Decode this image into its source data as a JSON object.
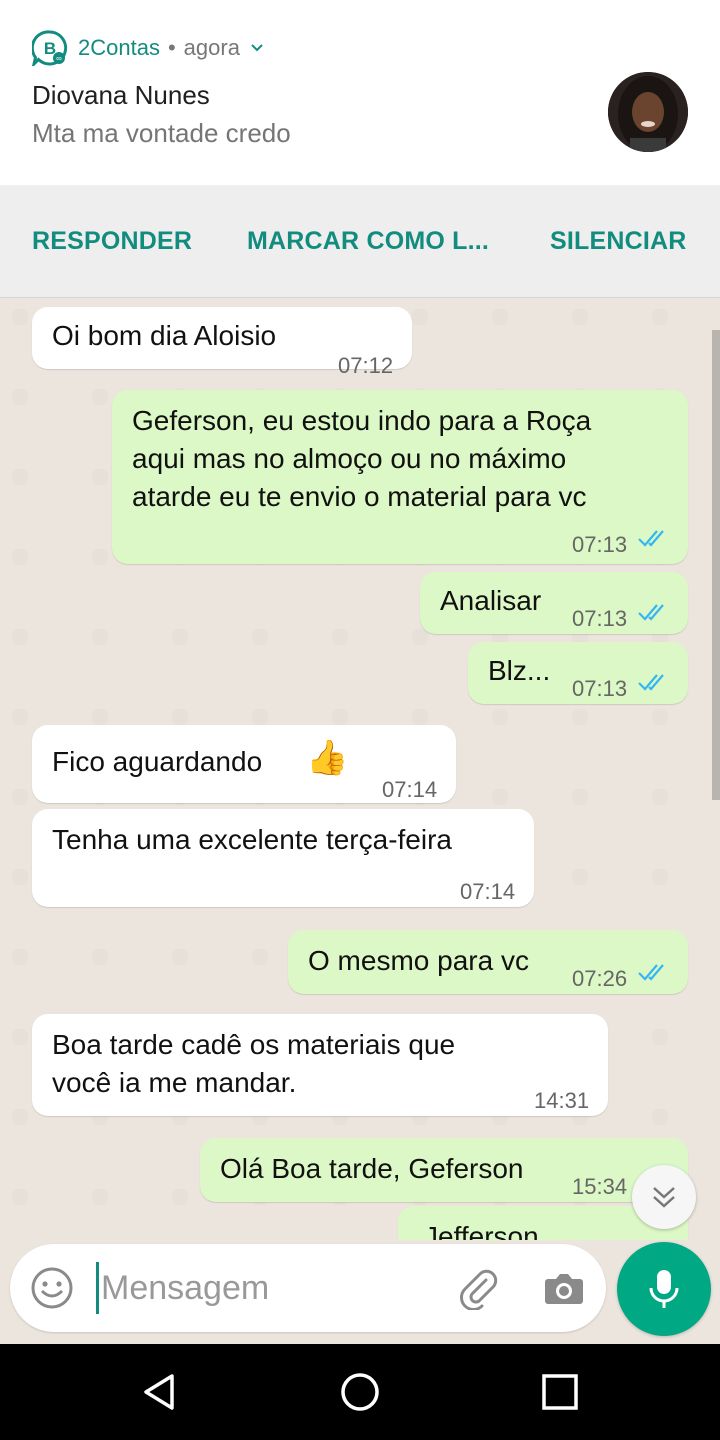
{
  "notification": {
    "app_name": "2Contas",
    "time": "agora",
    "sender": "Diovana Nunes",
    "preview": "Mta ma vontade credo",
    "actions": [
      "RESPONDER",
      "MARCAR COMO L...",
      "SILENCIAR"
    ],
    "accent_color": "#128c7e"
  },
  "messages": [
    {
      "dir": "in",
      "text": "Oi bom dia Aloisio",
      "time": "07:12"
    },
    {
      "dir": "out",
      "lines": [
        "Geferson, eu estou indo para a Roça",
        "aqui mas no almoço ou no máximo",
        "atarde eu te envio o material para vc"
      ],
      "time": "07:13",
      "status": "read"
    },
    {
      "dir": "out",
      "text": "Analisar",
      "time": "07:13",
      "status": "read"
    },
    {
      "dir": "out",
      "text": "Blz...",
      "time": "07:13",
      "status": "read"
    },
    {
      "dir": "in",
      "text": "Fico aguardando",
      "emoji": "👍",
      "time": "07:14"
    },
    {
      "dir": "in",
      "text": "Tenha uma excelente  terça-feira",
      "time": "07:14"
    },
    {
      "dir": "out",
      "text": "O mesmo para vc",
      "time": "07:26",
      "status": "read"
    },
    {
      "dir": "in",
      "lines": [
        "Boa tarde cadê os materiais  que",
        "você ia me  mandar."
      ],
      "time": "14:31"
    },
    {
      "dir": "out",
      "text": "Olá Boa tarde, Geferson",
      "time": "15:34",
      "status": "read"
    },
    {
      "dir": "out",
      "text": "Jefferson",
      "partial": true
    }
  ],
  "input": {
    "placeholder": "Mensagem"
  },
  "icons": [
    "emoji-icon",
    "attach-icon",
    "camera-icon",
    "mic-icon",
    "scroll-down-icon",
    "back-icon",
    "home-icon",
    "recents-icon"
  ],
  "colors": {
    "outgoing_bubble": "#dcf8c6",
    "incoming_bubble": "#ffffff",
    "read_ticks": "#34b7f1",
    "mic_button": "#00a884"
  }
}
